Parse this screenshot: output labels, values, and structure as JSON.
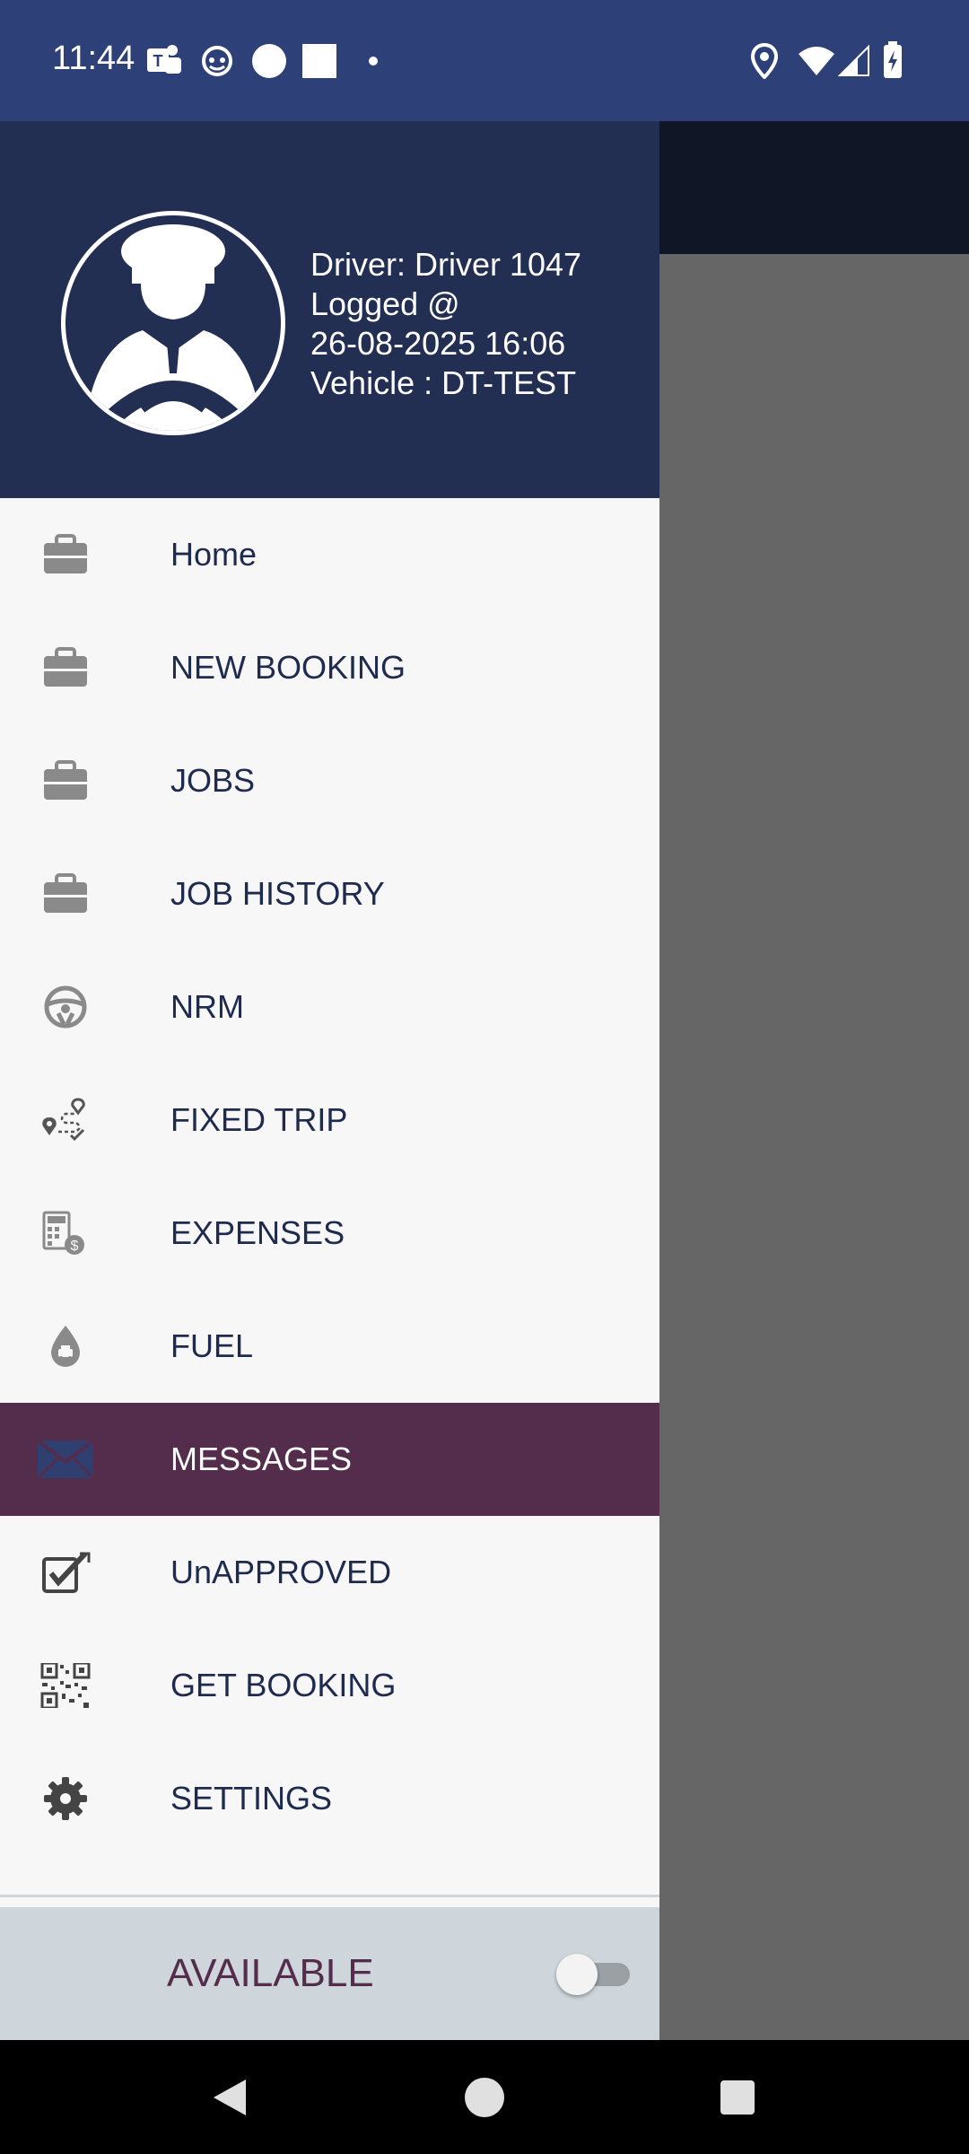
{
  "status_bar": {
    "time": "11:44",
    "left_icons": [
      "teams-icon",
      "face-icon",
      "circle-icon",
      "square-icon",
      "dot-icon"
    ],
    "right_icons": [
      "location-icon",
      "wifi-icon",
      "signal-icon",
      "battery-icon"
    ]
  },
  "drawer": {
    "header": {
      "driver": "Driver: Driver 1047",
      "logged": "Logged @",
      "datetime": "26-08-2025 16:06",
      "vehicle": "Vehicle : DT-TEST"
    },
    "items": [
      {
        "label": "Home",
        "icon": "briefcase-icon"
      },
      {
        "label": "NEW BOOKING",
        "icon": "briefcase-icon"
      },
      {
        "label": "JOBS",
        "icon": "briefcase-icon"
      },
      {
        "label": "JOB HISTORY",
        "icon": "briefcase-icon"
      },
      {
        "label": "NRM",
        "icon": "steering-wheel-icon"
      },
      {
        "label": "FIXED TRIP",
        "icon": "route-icon"
      },
      {
        "label": "EXPENSES",
        "icon": "calculator-dollar-icon"
      },
      {
        "label": "FUEL",
        "icon": "fuel-drop-icon"
      },
      {
        "label": "MESSAGES",
        "icon": "envelope-icon",
        "active": true
      },
      {
        "label": "UnAPPROVED",
        "icon": "checkbox-icon"
      },
      {
        "label": "GET BOOKING",
        "icon": "qr-code-icon"
      },
      {
        "label": "SETTINGS",
        "icon": "gear-icon"
      }
    ],
    "available": {
      "label": "AVAILABLE",
      "toggle_on": false
    }
  },
  "colors": {
    "header": "#222e52",
    "status_bar": "#2d4178",
    "active_item": "#542c4c",
    "menu_text": "#1e2a4e",
    "icon_gray": "#8a8a8a"
  }
}
